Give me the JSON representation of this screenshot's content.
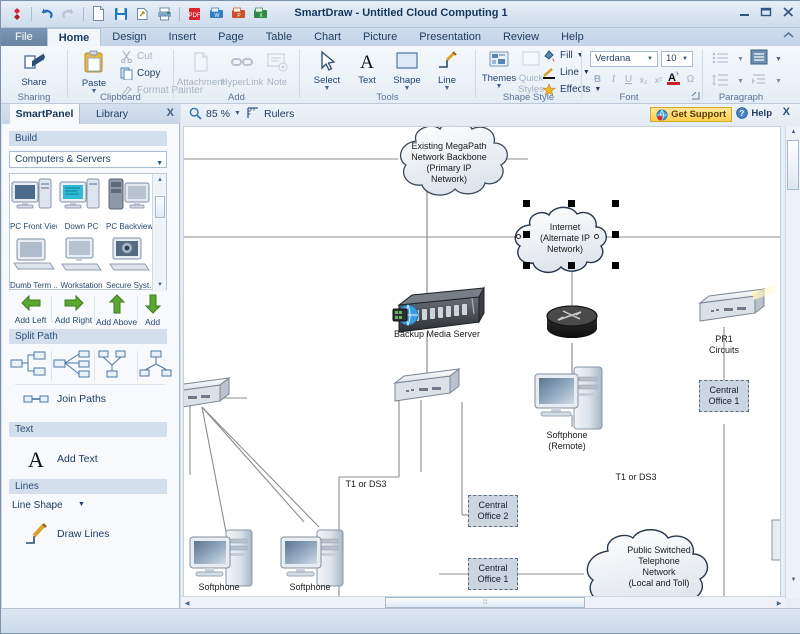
{
  "window": {
    "title": "SmartDraw - Untitled Cloud Computing 1",
    "minimize": "minimize-button",
    "restore": "restore-button",
    "close": "close-button"
  },
  "quick_access": [
    {
      "name": "smartdraw-logo-icon",
      "label": "SmartDraw"
    },
    {
      "name": "undo-icon",
      "label": "Undo"
    },
    {
      "name": "redo-icon",
      "label": "Redo"
    },
    {
      "name": "new-document-icon",
      "label": "New"
    },
    {
      "name": "save-icon",
      "label": "Save"
    },
    {
      "name": "save-as-icon",
      "label": "Save As"
    },
    {
      "name": "print-icon",
      "label": "Print"
    },
    {
      "name": "export-pdf-icon",
      "label": "PDF"
    },
    {
      "name": "export-word-icon",
      "label": "Word"
    },
    {
      "name": "export-powerpoint-icon",
      "label": "PowerPoint"
    },
    {
      "name": "export-excel-icon",
      "label": "Excel"
    }
  ],
  "menu_tabs": [
    {
      "label": "File",
      "state": "file"
    },
    {
      "label": "Home",
      "state": "active"
    },
    {
      "label": "Design",
      "state": "normal"
    },
    {
      "label": "Insert",
      "state": "normal"
    },
    {
      "label": "Page",
      "state": "normal"
    },
    {
      "label": "Table",
      "state": "normal"
    },
    {
      "label": "Chart",
      "state": "normal"
    },
    {
      "label": "Picture",
      "state": "normal"
    },
    {
      "label": "Presentation",
      "state": "normal"
    },
    {
      "label": "Review",
      "state": "normal"
    },
    {
      "label": "Help",
      "state": "normal"
    }
  ],
  "ribbon": {
    "groups": [
      {
        "label": "Sharing"
      },
      {
        "label": "Clipboard"
      },
      {
        "label": "Add"
      },
      {
        "label": "Tools"
      },
      {
        "label": "Shape Style"
      },
      {
        "label": "Font"
      },
      {
        "label": "Paragraph"
      }
    ],
    "share": "Share",
    "paste": "Paste",
    "cut": "Cut",
    "copy": "Copy",
    "format_painter": "Format Painter",
    "attachment": "Attachment",
    "hyperlink": "HyperLink",
    "note": "Note",
    "select": "Select",
    "text": "Text",
    "shape": "Shape",
    "line": "Line",
    "themes": "Themes",
    "quick_styles_1": "Quick",
    "quick_styles_2": "Styles",
    "fill": "Fill",
    "line_style": "Line",
    "effects": "Effects",
    "font_name": "Verdana",
    "font_size": "10"
  },
  "sidebar": {
    "tabs": [
      {
        "label": "SmartPanel",
        "state": "active"
      },
      {
        "label": "Library",
        "state": "normal"
      }
    ],
    "close": "X",
    "sections": {
      "build": "Build",
      "split_path": "Split Path",
      "text": "Text",
      "lines": "Lines"
    },
    "category": "Computers & Servers",
    "gallery": [
      {
        "caption": "PC Front View",
        "icon": "pc-front-view-icon"
      },
      {
        "caption": "Down PC",
        "icon": "down-pc-icon"
      },
      {
        "caption": "PC Backview",
        "icon": "pc-backview-icon"
      },
      {
        "caption": "Dumb Term ...",
        "icon": "dumb-terminal-icon"
      },
      {
        "caption": "Workstation",
        "icon": "workstation-icon"
      },
      {
        "caption": "Secure Syst...",
        "icon": "secure-system-icon"
      }
    ],
    "add_buttons": [
      {
        "label": "Add Left",
        "icon": "arrow-left-icon"
      },
      {
        "label": "Add Right",
        "icon": "arrow-right-icon"
      },
      {
        "label": "Add Above",
        "icon": "arrow-up-icon"
      },
      {
        "label": "Add Below",
        "icon": "arrow-down-icon"
      }
    ],
    "split_paths": [
      {
        "icon": "split-path-right-icon"
      },
      {
        "icon": "split-path-fan-icon"
      },
      {
        "icon": "split-path-down-icon"
      },
      {
        "icon": "split-path-branch-icon"
      }
    ],
    "join_paths": "Join Paths",
    "add_text": "Add Text",
    "line_shape": "Line Shape",
    "draw_lines": "Draw Lines"
  },
  "view_toolbar": {
    "zoom": "85 %",
    "rulers": "Rulers",
    "get_support": "Get Support",
    "help": "Help",
    "close_doc": "X"
  },
  "diagram": {
    "nodes": [
      {
        "id": "megapath-cloud",
        "type": "cloud",
        "label": "Existing MegaPath\nNetwork Backbone\n(Primary IP\nNetwork)"
      },
      {
        "id": "internet-cloud",
        "type": "cloud",
        "label": "Internet\n(Alternate IP\nNetwork)",
        "selected": true
      },
      {
        "id": "backup-media-server",
        "type": "server",
        "label": "Backup Media Server"
      },
      {
        "id": "router",
        "type": "router",
        "label": ""
      },
      {
        "id": "switch-right",
        "type": "switch",
        "label": ""
      },
      {
        "id": "switch-center",
        "type": "switch",
        "label": ""
      },
      {
        "id": "switch-left",
        "type": "switch",
        "label": ""
      },
      {
        "id": "softphone-remote",
        "type": "pc",
        "label": "Softphone\n(Remote)"
      },
      {
        "id": "softphone-1",
        "type": "pc",
        "label": "Softphone"
      },
      {
        "id": "softphone-2",
        "type": "pc",
        "label": "Softphone"
      },
      {
        "id": "pr1-circuits",
        "type": "text",
        "label": "PR1\nCircuits"
      },
      {
        "id": "central-office-1-top",
        "type": "box",
        "label": "Central\nOffice 1"
      },
      {
        "id": "central-office-2",
        "type": "box",
        "label": "Central\nOffice 2"
      },
      {
        "id": "central-office-1-bottom",
        "type": "box",
        "label": "Central\nOffice 1"
      },
      {
        "id": "pstn-cloud",
        "type": "cloud",
        "label": "Public Switched\nTelephone\nNetwork\n(Local and Toll)"
      },
      {
        "id": "link-label-t1ds3-a",
        "type": "text",
        "label": "T1 or DS3"
      },
      {
        "id": "link-label-t1ds3-b",
        "type": "text",
        "label": "T1 or DS3"
      }
    ]
  }
}
